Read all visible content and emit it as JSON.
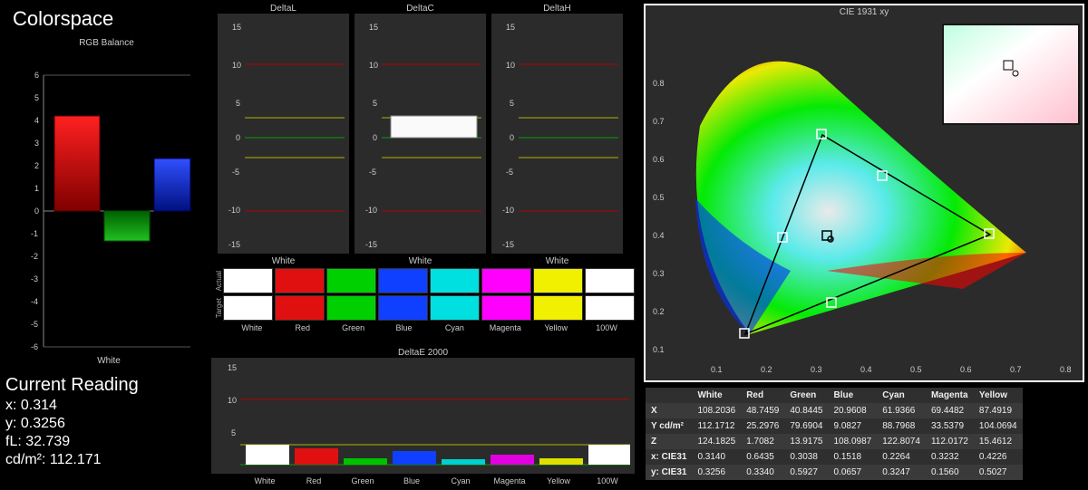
{
  "title": "Colorspace",
  "rgb_balance": {
    "title": "RGB Balance",
    "xaxis_label": "White"
  },
  "delta_panels": {
    "l": {
      "title": "DeltaL",
      "xaxis_label": "White"
    },
    "c": {
      "title": "DeltaC",
      "xaxis_label": "White"
    },
    "h": {
      "title": "DeltaH",
      "xaxis_label": "White"
    }
  },
  "swatches": {
    "row1_label": "Actual",
    "row2_label": "Target",
    "labels": [
      "White",
      "Red",
      "Green",
      "Blue",
      "Cyan",
      "Magenta",
      "Yellow",
      "100W"
    ]
  },
  "deltaE": {
    "title": "DeltaE 2000",
    "labels": [
      "White",
      "Red",
      "Green",
      "Blue",
      "Cyan",
      "Magenta",
      "Yellow",
      "100W"
    ]
  },
  "reading": {
    "title": "Current Reading",
    "x_label": "x:",
    "x_val": "0.314",
    "y_label": "y:",
    "y_val": "0.3256",
    "fl_label": "fL:",
    "fl_val": "32.739",
    "cd_label": "cd/m²:",
    "cd_val": "112.171"
  },
  "cie": {
    "title": "CIE 1931 xy"
  },
  "table": {
    "headers": [
      "",
      "White",
      "Red",
      "Green",
      "Blue",
      "Cyan",
      "Magenta",
      "Yellow"
    ],
    "rows": [
      {
        "h": "X",
        "v": [
          "108.2036",
          "48.7459",
          "40.8445",
          "20.9608",
          "61.9366",
          "69.4482",
          "87.4919"
        ]
      },
      {
        "h": "Y cd/m²",
        "v": [
          "112.1712",
          "25.2976",
          "79.6904",
          "9.0827",
          "88.7968",
          "33.5379",
          "104.0694"
        ]
      },
      {
        "h": "Z",
        "v": [
          "124.1825",
          "1.7082",
          "13.9175",
          "108.0987",
          "122.8074",
          "112.0172",
          "15.4612"
        ]
      },
      {
        "h": "x: CIE31",
        "v": [
          "0.3140",
          "0.6435",
          "0.3038",
          "0.1518",
          "0.2264",
          "0.3232",
          "0.4226"
        ]
      },
      {
        "h": "y: CIE31",
        "v": [
          "0.3256",
          "0.3340",
          "0.5927",
          "0.0657",
          "0.3247",
          "0.1560",
          "0.5027"
        ]
      }
    ]
  },
  "chart_data": [
    {
      "name": "RGB Balance",
      "type": "bar",
      "categories": [
        "Red",
        "Green",
        "Blue"
      ],
      "values": [
        4.2,
        -1.3,
        2.3
      ],
      "ylim": [
        -6,
        6
      ],
      "yticks": [
        -6,
        -5,
        -4,
        -3,
        -2,
        -1,
        0,
        1,
        2,
        3,
        4,
        5,
        6
      ],
      "xlabel": "White"
    },
    {
      "name": "DeltaL",
      "type": "bar",
      "categories": [
        "White"
      ],
      "values": [
        0
      ],
      "ref_lines": {
        "red_pos": 10,
        "red_neg": -10,
        "yellow_pos": 3,
        "yellow_neg": -3,
        "green": 0
      },
      "ylim": [
        -15,
        15
      ]
    },
    {
      "name": "DeltaC",
      "type": "bar",
      "categories": [
        "White"
      ],
      "values": [
        3
      ],
      "bar_color": "#ffffff",
      "ref_lines": {
        "red_pos": 10,
        "red_neg": -10,
        "yellow_pos": 3,
        "yellow_neg": -3,
        "green": 0
      },
      "ylim": [
        -15,
        15
      ]
    },
    {
      "name": "DeltaH",
      "type": "bar",
      "categories": [
        "White"
      ],
      "values": [
        0
      ],
      "ref_lines": {
        "red_pos": 10,
        "red_neg": -10,
        "yellow_pos": 3,
        "yellow_neg": -3,
        "green": 0
      },
      "ylim": [
        -15,
        15
      ]
    },
    {
      "name": "DeltaE 2000",
      "type": "bar",
      "categories": [
        "White",
        "Red",
        "Green",
        "Blue",
        "Cyan",
        "Magenta",
        "Yellow",
        "100W"
      ],
      "values": [
        3.0,
        2.5,
        1.0,
        2.0,
        0.8,
        1.5,
        1.0,
        3.0
      ],
      "bar_colors": [
        "#ffffff",
        "#e01010",
        "#00c000",
        "#1040ff",
        "#00d0d0",
        "#e000e0",
        "#e0e000",
        "#ffffff"
      ],
      "ref_lines": {
        "red": 10,
        "yellow": 3
      },
      "ylim": [
        0,
        15
      ]
    },
    {
      "name": "CIE 1931 xy",
      "type": "scatter",
      "xlim": [
        0,
        0.85
      ],
      "ylim": [
        0,
        0.9
      ],
      "xticks": [
        0.1,
        0.2,
        0.3,
        0.4,
        0.5,
        0.6,
        0.7,
        0.8
      ],
      "yticks": [
        0.1,
        0.2,
        0.3,
        0.4,
        0.5,
        0.6,
        0.7,
        0.8
      ],
      "triangle_targets": [
        {
          "name": "Red",
          "x": 0.64,
          "y": 0.33
        },
        {
          "name": "Green",
          "x": 0.3,
          "y": 0.6
        },
        {
          "name": "Blue",
          "x": 0.15,
          "y": 0.06
        }
      ],
      "measured_points": [
        {
          "name": "White",
          "x": 0.314,
          "y": 0.3256
        },
        {
          "name": "Red",
          "x": 0.6435,
          "y": 0.334
        },
        {
          "name": "Green",
          "x": 0.3038,
          "y": 0.5927
        },
        {
          "name": "Blue",
          "x": 0.1518,
          "y": 0.0657
        },
        {
          "name": "Cyan",
          "x": 0.2264,
          "y": 0.3247
        },
        {
          "name": "Magenta",
          "x": 0.3232,
          "y": 0.156
        },
        {
          "name": "Yellow",
          "x": 0.4226,
          "y": 0.5027
        }
      ]
    }
  ]
}
